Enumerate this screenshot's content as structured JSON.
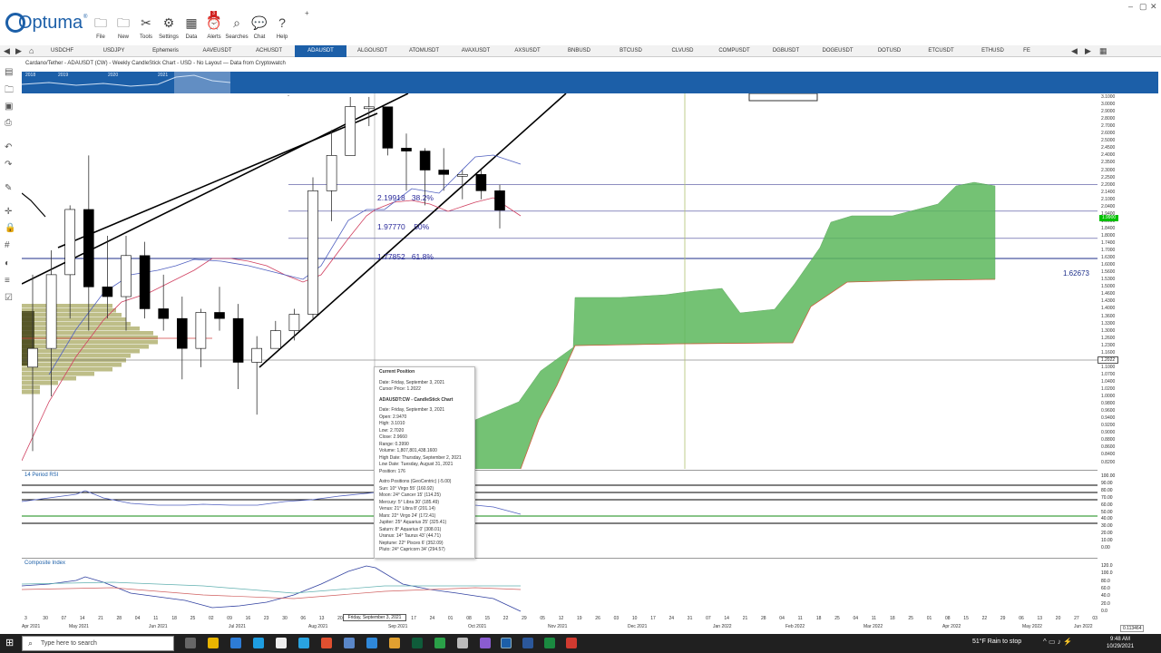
{
  "app": {
    "name": "Optuma",
    "trademark": "®"
  },
  "ribbon": [
    {
      "label": "File",
      "icon": "folder-icon",
      "glyph": "🗀"
    },
    {
      "label": "New",
      "icon": "new-folder-icon",
      "glyph": "🗀"
    },
    {
      "label": "Tools",
      "icon": "tools-icon",
      "glyph": "✂"
    },
    {
      "label": "Settings",
      "icon": "settings-icon",
      "glyph": "⚙"
    },
    {
      "label": "Data",
      "icon": "data-icon",
      "glyph": "▦"
    },
    {
      "label": "Alerts",
      "icon": "alarm-icon",
      "glyph": "⏰"
    },
    {
      "label": "Searches",
      "icon": "search-icon",
      "glyph": "⌕"
    },
    {
      "label": "Chat",
      "icon": "chat-icon",
      "glyph": "💬"
    },
    {
      "label": "Help",
      "icon": "help-icon",
      "glyph": "?"
    }
  ],
  "alert_badge": "3",
  "tabs": [
    "USDCHF",
    "USDJPY",
    "Ephemeris",
    "AAVEUSDT",
    "ACHUSDT",
    "ADAUSDT",
    "ALGOUSDT",
    "ATOMUSDT",
    "AVAXUSDT",
    "AXSUSDT",
    "BNBUSD",
    "BTCUSD",
    "CLVUSD",
    "COMPUSDT",
    "DGBUSDT",
    "DOGEUSDT",
    "DOTUSD",
    "ETCUSDT",
    "ETHUSD",
    "FE"
  ],
  "active_tab": "ADAUSDT",
  "chart_title": "Cardano/Tether - ADAUSDT (CW) - Weekly CandleStick Chart - USD - No Layout — Data from Cryptowatch",
  "overview_years": [
    "2018",
    "2019",
    "2020",
    "2021"
  ],
  "fib_levels": [
    {
      "price": "2.19918",
      "pct": "38.2%"
    },
    {
      "price": "1.97770",
      "pct": "50%"
    },
    {
      "price": "1.77852",
      "pct": "61.8%"
    }
  ],
  "fib_extra": "1.62673",
  "price_axis": [
    "3.1000",
    "3.0000",
    "2.9000",
    "2.8000",
    "2.7000",
    "2.6000",
    "2.5000",
    "2.4500",
    "2.4000",
    "2.3500",
    "2.3000",
    "2.2500",
    "2.2000",
    "2.1400",
    "2.1000",
    "2.0400",
    "1.9400",
    "1.9000",
    "1.8400",
    "1.8000",
    "1.7400",
    "1.7000",
    "1.6300",
    "1.6000",
    "1.5600",
    "1.5300",
    "1.5000",
    "1.4600",
    "1.4300",
    "1.4000",
    "1.3600",
    "1.3300",
    "1.3000",
    "1.2600",
    "1.2300",
    "1.1600",
    "1.1300",
    "1.1000",
    "1.0700",
    "1.0400",
    "1.0200",
    "1.0000",
    "0.9800",
    "0.9600",
    "0.9400",
    "0.9200",
    "0.9000",
    "0.8800",
    "0.8600",
    "0.8400",
    "0.8200"
  ],
  "last_price": "1.9900",
  "cursor_price": "1.2022",
  "rsi_label": "14 Period RSI",
  "rsi_axis": [
    "100.00",
    "90.00",
    "80.00",
    "70.00",
    "60.00",
    "50.00",
    "40.00",
    "30.00",
    "20.00",
    "10.00",
    "0.00"
  ],
  "comp_label": "Composite Index",
  "comp_axis": [
    "120.0",
    "100.0",
    "80.0",
    "60.0",
    "40.0",
    "20.0",
    "0.0"
  ],
  "popup": {
    "title": "Current Position",
    "date": "Date: Friday, September 3, 2021",
    "cursor": "Cursor Price: 1.2022",
    "chart_head": "ADAUSDT:CW - CandleStick Chart",
    "details": [
      "Date: Friday, September 3, 2021",
      "Open: 2.9470",
      "High: 3.1010",
      "Low: 2.7020",
      "Close: 2.9660",
      "Range: 0.3990",
      "Volume: 1,807,801,438.1600",
      "High Date: Thursday, September 2, 2021",
      "Low Date: Tuesday, August 31, 2021",
      "Position: 176"
    ],
    "astro_head": "Astro Positions (GeoCentric) (-5.00)",
    "astro": [
      "Sun: 10° Virgo 55' (160.92)",
      "Moon: 24° Cancer 15' (114.25)",
      "Mercury: 5° Libra 30' (185.49)",
      "Venus: 21° Libra 8' (201.14)",
      "Mars: 22° Virgo 24' (172.41)",
      "Jupiter: 25° Aquarius 25' (325.41)",
      "Saturn: 8° Aquarius 0' (308.01)",
      "Uranus: 14° Taurus 43' (44.71)",
      "Neptune: 22° Pisces 6' (352.09)",
      "Pluto: 24° Capricorn 34' (294.57)"
    ]
  },
  "cursor_date": "Friday, September 3, 2021",
  "x_days": [
    "3",
    "30",
    "07",
    "14",
    "21",
    "28",
    "04",
    "11",
    "18",
    "25",
    "02",
    "09",
    "16",
    "23",
    "30",
    "06",
    "13",
    "20",
    "27",
    "03",
    "10",
    "17",
    "24",
    "01",
    "08",
    "15",
    "22",
    "29",
    "05",
    "12",
    "19",
    "26",
    "03",
    "10",
    "17",
    "24",
    "31",
    "07",
    "14",
    "21",
    "28",
    "04",
    "11",
    "18",
    "25",
    "04",
    "11",
    "18",
    "25",
    "01",
    "08",
    "15",
    "22",
    "29",
    "06",
    "13",
    "20",
    "27",
    "03"
  ],
  "x_months": [
    "Apr 2021",
    "May 2021",
    "Jun 2021",
    "Jul 2021",
    "Aug 2021",
    "Sep 2021",
    "Oct 2021",
    "Nov 2021",
    "Dec 2021",
    "Jan 2022",
    "Feb 2022",
    "Mar 2022",
    "Apr 2022",
    "May 2022",
    "Jun 2022"
  ],
  "status_value": "0.113464",
  "taskbar": {
    "search_placeholder": "Type here to search",
    "weather": "51°F  Rain to stop",
    "time": "9:48 AM",
    "date": "10/29/2021"
  },
  "colors": {
    "accent": "#1c5fa8",
    "cloud": "#5cb85c",
    "volume": "#a8a860"
  },
  "chart_data": {
    "type": "candlestick",
    "title": "Cardano/Tether - ADAUSDT (CW) - Weekly CandleStick Chart - USD",
    "candles_ohlc": [
      [
        1.1,
        1.55,
        0.85,
        1.2
      ],
      [
        1.2,
        1.7,
        1.0,
        1.55
      ],
      [
        1.55,
        2.05,
        1.35,
        2.0
      ],
      [
        2.0,
        2.4,
        1.3,
        1.5
      ],
      [
        1.5,
        1.8,
        1.35,
        1.45
      ],
      [
        1.45,
        1.8,
        1.3,
        1.65
      ],
      [
        1.65,
        1.75,
        1.35,
        1.4
      ],
      [
        1.4,
        1.55,
        1.3,
        1.35
      ],
      [
        1.35,
        1.45,
        1.05,
        1.2
      ],
      [
        1.2,
        1.4,
        1.1,
        1.38
      ],
      [
        1.38,
        1.5,
        1.3,
        1.35
      ],
      [
        1.35,
        1.42,
        1.02,
        1.12
      ],
      [
        1.12,
        1.27,
        0.95,
        1.2
      ],
      [
        1.2,
        1.34,
        1.2,
        1.3
      ],
      [
        1.3,
        1.4,
        1.25,
        1.37
      ],
      [
        1.37,
        2.25,
        1.35,
        2.15
      ],
      [
        2.15,
        2.65,
        1.9,
        2.4
      ],
      [
        2.4,
        3.1,
        2.45,
        2.97
      ],
      [
        2.947,
        3.101,
        2.702,
        2.966
      ],
      [
        2.966,
        2.7,
        2.4,
        2.45
      ],
      [
        2.45,
        2.6,
        2.15,
        2.43
      ],
      [
        2.43,
        2.45,
        2.05,
        2.3
      ],
      [
        2.3,
        2.45,
        2.15,
        2.27
      ],
      [
        2.27,
        2.3,
        2.1,
        2.27
      ],
      [
        2.27,
        2.3,
        2.1,
        2.15
      ],
      [
        2.15,
        2.2,
        1.84,
        1.99
      ]
    ],
    "fib_retracement": [
      2.19918,
      1.9777,
      1.77852,
      1.62673
    ],
    "ylim": [
      0.82,
      3.1
    ]
  }
}
